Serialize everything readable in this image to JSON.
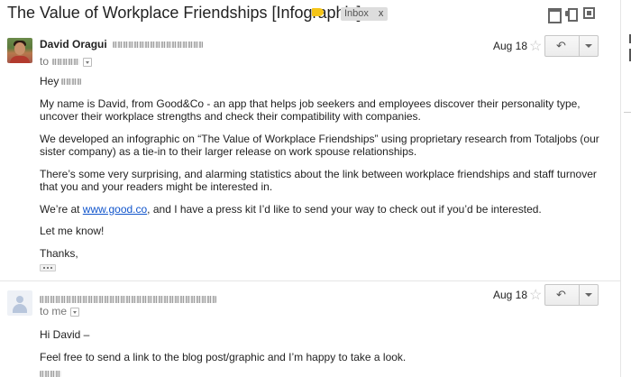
{
  "subject": "The Value of Workplace Friendships [Infographic]",
  "labels": {
    "inbox": "Inbox",
    "close": "x"
  },
  "icons": {
    "label": "label-icon",
    "archive": "archive-icon",
    "print": "print-icon",
    "new_window": "new-window-icon",
    "star": "star-icon",
    "reply": "reply-icon",
    "more": "chevron-down-icon"
  },
  "colors": {
    "label_yellow": "#f5c518",
    "link": "#1155cc",
    "chip_bg": "#dddddd"
  },
  "messages": [
    {
      "sender_name": "David Oragui",
      "to_prefix": "to",
      "date": "Aug 18",
      "greeting": "Hey",
      "paragraphs": [
        "My name is David, from Good&Co - an app that helps job seekers and employees discover their personality type, uncover their workplace strengths and check their compatibility with companies.",
        "We developed an infographic on “The Value of Workplace Friendships” using proprietary research from Totaljobs (our sister company) as a tie-in to their larger release on work spouse relationships.",
        "There’s some very surprising, and alarming statistics about the link between workplace friendships and staff turnover that you and your readers might be interested in."
      ],
      "link_para": {
        "before": "We’re at ",
        "link": "www.good.co",
        "after": ", and I have a press kit I’d like to send your way to check out if you’d be interested."
      },
      "closing": [
        "Let me know!",
        "Thanks,"
      ]
    },
    {
      "to_prefix": "to me",
      "date": "Aug 18",
      "greeting": "Hi David –",
      "paragraphs": [
        "Feel free to send a link to the blog post/graphic and I’m happy to take a look."
      ]
    }
  ]
}
